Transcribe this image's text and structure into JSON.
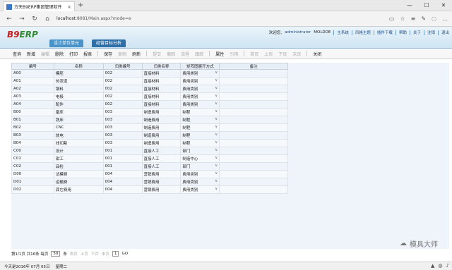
{
  "browser": {
    "tab_title": "方天B9ERP集团管理软件",
    "tab_close": "×",
    "new_tab": "+",
    "url_host": "localhost",
    "url_rest": ":8081/Main.aspx?mode=e",
    "win_min": "—",
    "win_max": "☐",
    "win_close": "✕"
  },
  "app": {
    "logo_main": "B9",
    "logo_sub": "ERP",
    "tabs": [
      "设计单位单元",
      "经营目标分析"
    ],
    "user_greeting": "欢迎您,",
    "user_name": "administrator",
    "company": "MOLDDE",
    "links": [
      "主系统",
      "风格主题",
      "插件下载",
      "帮助",
      "关于",
      "注销",
      "退出"
    ]
  },
  "toolbar": {
    "items": [
      {
        "label": "查询",
        "enabled": true
      },
      {
        "label": "新增",
        "enabled": true
      },
      {
        "label": "编辑",
        "enabled": false
      },
      {
        "label": "删除",
        "enabled": true
      },
      {
        "label": "打印",
        "enabled": true
      },
      {
        "label": "报表",
        "enabled": true
      },
      {
        "label": "保存",
        "enabled": true
      },
      {
        "label": "复制",
        "enabled": false
      },
      {
        "label": "刷新",
        "enabled": true
      },
      {
        "label": "提交",
        "enabled": false
      },
      {
        "label": "撤回",
        "enabled": false
      },
      {
        "label": "流程",
        "enabled": false
      },
      {
        "label": "跟踪",
        "enabled": false
      },
      {
        "label": "属性",
        "enabled": true
      },
      {
        "label": "引用",
        "enabled": false
      },
      {
        "label": "首页",
        "enabled": false
      },
      {
        "label": "上页",
        "enabled": false
      },
      {
        "label": "下页",
        "enabled": false
      },
      {
        "label": "末页",
        "enabled": false
      },
      {
        "label": "关闭",
        "enabled": true
      }
    ]
  },
  "grid": {
    "columns": [
      "编号",
      "名称",
      "归类编号",
      "归类名称",
      "矩阵图展开方式",
      "备注"
    ],
    "rows": [
      [
        "A00",
        "模胚",
        "002",
        "直接材料",
        "费用类别",
        ""
      ],
      [
        "A01",
        "热流道",
        "002",
        "直接材料",
        "费用类别",
        ""
      ],
      [
        "A02",
        "钢料",
        "002",
        "直接材料",
        "费用类别",
        ""
      ],
      [
        "A03",
        "电极",
        "002",
        "直接材料",
        "费用类别",
        ""
      ],
      [
        "A04",
        "配件",
        "002",
        "直接材料",
        "费用类别",
        ""
      ],
      [
        "B00",
        "磨床",
        "003",
        "制造费用",
        "制程",
        ""
      ],
      [
        "B01",
        "铣床",
        "003",
        "制造费用",
        "制程",
        ""
      ],
      [
        "B02",
        "CNC",
        "003",
        "制造费用",
        "制程",
        ""
      ],
      [
        "B03",
        "放电",
        "003",
        "制造费用",
        "制程",
        ""
      ],
      [
        "B04",
        "线切割",
        "003",
        "制造费用",
        "制程",
        ""
      ],
      [
        "C00",
        "设计",
        "001",
        "直接人工",
        "部门",
        ""
      ],
      [
        "C01",
        "钳工",
        "001",
        "直接人工",
        "制造中心",
        ""
      ],
      [
        "C02",
        "品检",
        "001",
        "直接人工",
        "部门",
        ""
      ],
      [
        "D00",
        "试模费",
        "004",
        "营销费用",
        "费用类别",
        ""
      ],
      [
        "D01",
        "运输费",
        "004",
        "营销费用",
        "费用类别",
        ""
      ],
      [
        "D02",
        "其它费用",
        "004",
        "营销费用",
        "费用类别",
        ""
      ]
    ]
  },
  "pager": {
    "summary": "第1/1页 共16条 每页",
    "page_size": "50",
    "unit": "条",
    "first": "首页",
    "prev": "上页",
    "next": "下页",
    "last": "末页",
    "current": "1",
    "go": "GO"
  },
  "status": {
    "date": "今天是2016年 07月 05日",
    "weekday": "星期二"
  },
  "watermark": "模具大师"
}
